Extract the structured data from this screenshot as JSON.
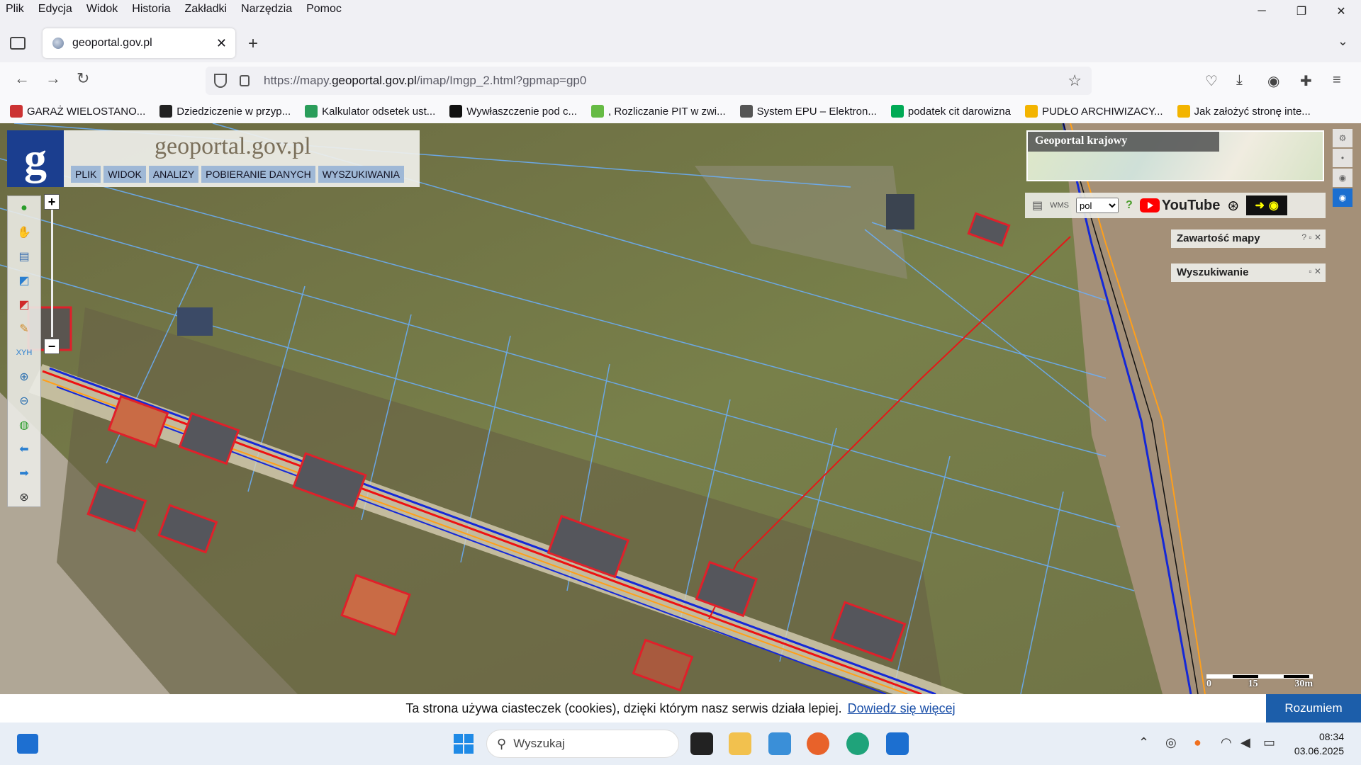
{
  "menu": [
    "Plik",
    "Edycja",
    "Widok",
    "Historia",
    "Zakładki",
    "Narzędzia",
    "Pomoc"
  ],
  "tab": {
    "title": "geoportal.gov.pl"
  },
  "address": {
    "prefix": "https://mapy.",
    "domain": "geoportal.gov.pl",
    "path": "/imap/Imgp_2.html?gpmap=gp0"
  },
  "bookmarks": [
    {
      "label": "GARAŻ WIELOSTANO...",
      "color": "#c33"
    },
    {
      "label": "Dziedziczenie w przyp...",
      "color": "#222"
    },
    {
      "label": "Kalkulator odsetek ust...",
      "color": "#2a9d5a"
    },
    {
      "label": "Wywłaszczenie pod c...",
      "color": "#111"
    },
    {
      "label": ", Rozliczanie PIT w zwi...",
      "color": "#6b4"
    },
    {
      "label": "System EPU – Elektron...",
      "color": "#555"
    },
    {
      "label": "podatek cit darowizna",
      "color": "#0a5"
    },
    {
      "label": "PUDŁO ARCHIWIZACY...",
      "color": "#f3b400"
    },
    {
      "label": "Jak założyć stronę inte...",
      "color": "#f3b400"
    }
  ],
  "app": {
    "logo_letter": "g",
    "title": "geoportal.gov.pl",
    "top_menu": [
      "PLIK",
      "WIDOK",
      "ANALIZY",
      "POBIERANIE DANYCH",
      "WYSZUKIWANIA"
    ],
    "overview_label": "Geoportal krajowy",
    "language": "pol",
    "youtube_label": "YouTube",
    "panels": [
      {
        "title": "Zawartość mapy",
        "controls": "? ▫ ✕"
      },
      {
        "title": "Wyszukiwanie",
        "controls": "▫ ✕"
      }
    ],
    "zoom_in": "+",
    "zoom_out": "−",
    "scale_labels": [
      "0",
      "15",
      "30m"
    ]
  },
  "cookie": {
    "text": "Ta strona używa ciasteczek (cookies), dzięki którym nasz serwis działa lepiej.",
    "link": "Dowiedz się więcej",
    "button": "Rozumiem"
  },
  "taskbar": {
    "search_placeholder": "Wyszukaj",
    "time": "08:34",
    "date": "03.06.2025"
  }
}
